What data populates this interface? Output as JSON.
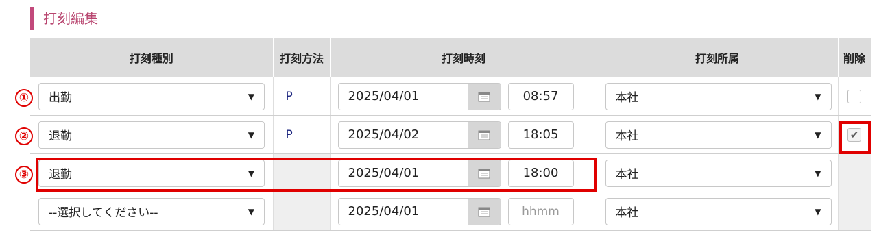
{
  "section": {
    "title": "打刻編集"
  },
  "table": {
    "headers": {
      "type": "打刻種別",
      "method": "打刻方法",
      "time": "打刻時刻",
      "affiliation": "打刻所属",
      "delete": "削除"
    },
    "rows": [
      {
        "marker": "①",
        "type": "出勤",
        "method": "P",
        "date": "2025/04/01",
        "time": "08:57",
        "affiliation": "本社",
        "delete_checked": false
      },
      {
        "marker": "②",
        "type": "退勤",
        "method": "P",
        "date": "2025/04/02",
        "time": "18:05",
        "affiliation": "本社",
        "delete_checked": true,
        "check_mark": "✔"
      },
      {
        "marker": "③",
        "type": "退勤",
        "method": "",
        "date": "2025/04/01",
        "time": "18:00",
        "affiliation": "本社"
      },
      {
        "marker": "",
        "type": "--選択してください--",
        "method": "",
        "date": "2025/04/01",
        "time": "",
        "time_placeholder": "hhmm",
        "affiliation": "本社"
      }
    ]
  },
  "icons": {
    "caret": "▼",
    "calendar": "calendar-icon"
  },
  "colors": {
    "accent": "#c2497b",
    "highlight": "#e00000",
    "header_bg": "#dcdcdc"
  }
}
